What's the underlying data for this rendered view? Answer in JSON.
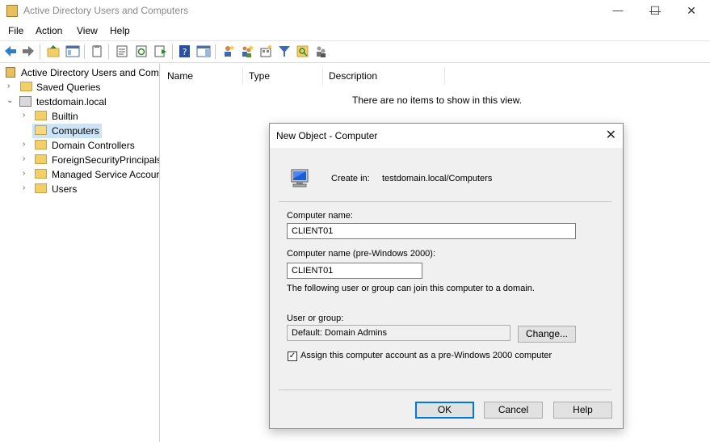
{
  "window": {
    "title": "Active Directory Users and Computers",
    "controls": {
      "minimize": "—",
      "maximize": "☐",
      "close": "✕"
    }
  },
  "menu": {
    "items": [
      "File",
      "Action",
      "View",
      "Help"
    ]
  },
  "tree": {
    "root": "Active Directory Users and Com",
    "items": [
      {
        "label": "Saved Queries"
      },
      {
        "label": "testdomain.local"
      },
      {
        "label": "Builtin"
      },
      {
        "label": "Computers"
      },
      {
        "label": "Domain Controllers"
      },
      {
        "label": "ForeignSecurityPrincipals"
      },
      {
        "label": "Managed Service Accour"
      },
      {
        "label": "Users"
      }
    ],
    "selected": "Computers"
  },
  "list": {
    "columns": [
      "Name",
      "Type",
      "Description"
    ],
    "empty_message": "There are no items to show in this view."
  },
  "dialog": {
    "title": "New Object - Computer",
    "create_in_label": "Create in:",
    "create_in_value": "testdomain.local/Computers",
    "computer_name_label": "Computer name:",
    "computer_name_value": "CLIENT01",
    "pre2000_label": "Computer name (pre-Windows 2000):",
    "pre2000_value": "CLIENT01",
    "join_note": "The following user or group can join this computer to a domain.",
    "user_group_label": "User or group:",
    "user_group_value": "Default: Domain Admins",
    "change_label": "Change...",
    "checkbox_label": "Assign this computer account as a pre-Windows 2000 computer",
    "checkbox_checked": true,
    "ok_label": "OK",
    "cancel_label": "Cancel",
    "help_label": "Help"
  },
  "colors": {
    "accent": "#0078d7",
    "selection": "#cce4f7",
    "folder": "#f3cf6a"
  }
}
